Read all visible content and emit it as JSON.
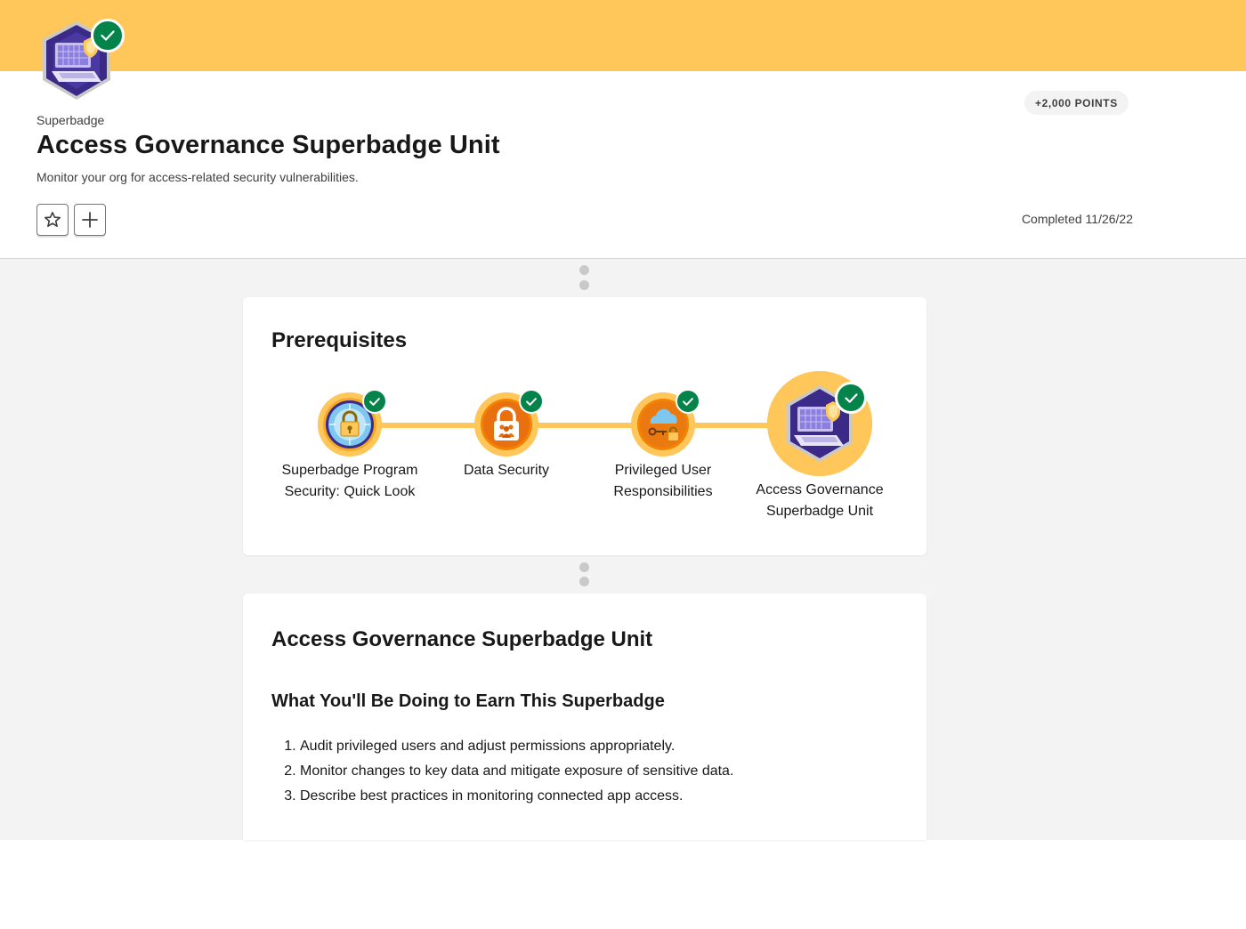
{
  "header": {
    "eyebrow": "Superbadge",
    "title": "Access Governance Superbadge Unit",
    "subtitle": "Monitor your org for access-related security vulnerabilities.",
    "points": "+2,000 POINTS",
    "completed": "Completed 11/26/22",
    "actions": [
      {
        "name": "favorite",
        "icon": "star-icon"
      },
      {
        "name": "add-to-trailmix",
        "icon": "plus-icon"
      }
    ]
  },
  "prerequisites": {
    "heading": "Prerequisites",
    "steps": [
      {
        "label": "Superbadge Program Security: Quick Look",
        "icon": "lock-icon",
        "completed": true
      },
      {
        "label": "Data Security",
        "icon": "people-lock-icon",
        "completed": true
      },
      {
        "label": "Privileged User Responsibilities",
        "icon": "cloud-key-icon",
        "completed": true
      },
      {
        "label": "Access Governance Superbadge Unit",
        "icon": "laptop-shield-icon",
        "completed": true
      }
    ]
  },
  "unit": {
    "title": "Access Governance Superbadge Unit",
    "section_heading": "What You'll Be Doing to Earn This Superbadge",
    "tasks": [
      "Audit privileged users and adjust permissions appropriately.",
      "Monitor changes to key data and mitigate exposure of sensitive data.",
      "Describe best practices in monitoring connected app access."
    ]
  },
  "colors": {
    "accent_yellow": "#ffc75a",
    "success_green": "#04844b",
    "badge_purple": "#3b2a88",
    "orange": "#f38303"
  }
}
